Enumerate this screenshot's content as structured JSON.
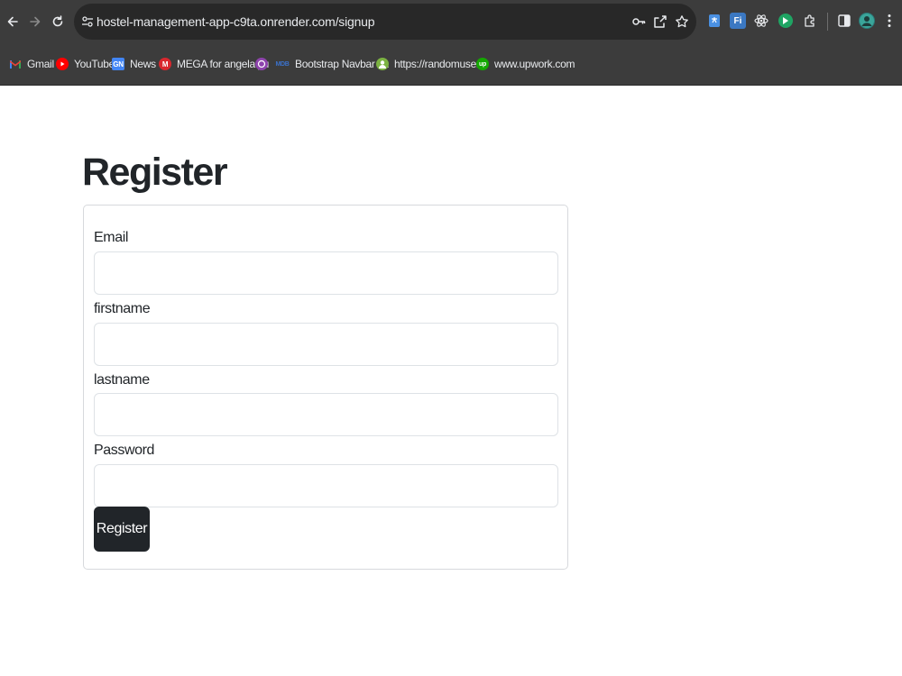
{
  "browser": {
    "url": "hostel-management-app-c9ta.onrender.com/signup",
    "bookmarks": [
      {
        "label": "Gmail",
        "icon": "gmail-icon"
      },
      {
        "label": "YouTube",
        "icon": "youtube-icon"
      },
      {
        "label": "News",
        "icon": "news-icon"
      },
      {
        "label": "MEGA for angela yu",
        "icon": "mega-icon"
      },
      {
        "label": "",
        "icon": "purple-app-icon"
      },
      {
        "label": "Bootstrap Navbar -...",
        "icon": "mdb-icon"
      },
      {
        "label": "https://randomuser...",
        "icon": "randomuser-icon"
      },
      {
        "label": "www.upwork.com",
        "icon": "upwork-icon"
      }
    ],
    "extensions": [
      {
        "name": "translate-extension-icon",
        "text": ""
      },
      {
        "name": "fi-extension-icon",
        "text": "Fi"
      },
      {
        "name": "react-devtools-icon",
        "text": ""
      },
      {
        "name": "green-extension-icon",
        "text": ""
      },
      {
        "name": "extensions-puzzle-icon",
        "text": ""
      }
    ],
    "colors": {
      "chrome": "#3c3c3c",
      "omnibox": "#282828"
    }
  },
  "page": {
    "title": "Register",
    "form": {
      "fields": [
        {
          "label": "Email",
          "value": "",
          "placeholder": ""
        },
        {
          "label": "firstname",
          "value": "",
          "placeholder": ""
        },
        {
          "label": "lastname",
          "value": "",
          "placeholder": ""
        },
        {
          "label": "Password",
          "value": "",
          "placeholder": ""
        }
      ],
      "submit_label": "Register"
    },
    "colors": {
      "button": "#212529",
      "text": "#212529"
    }
  }
}
